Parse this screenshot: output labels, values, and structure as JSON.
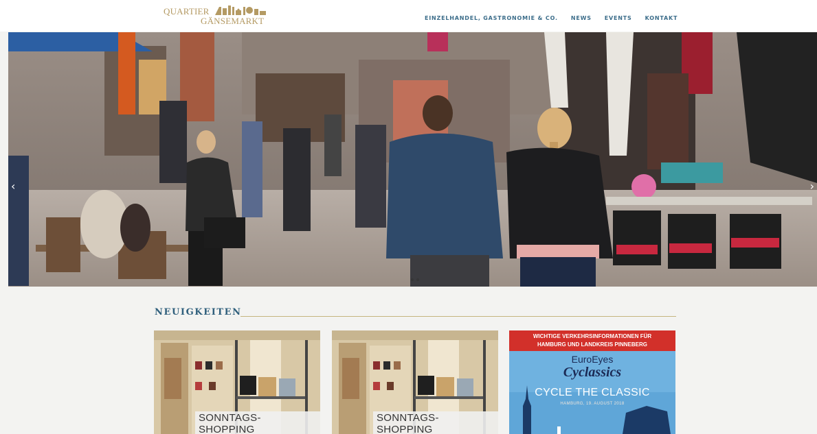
{
  "logo": {
    "line1": "QUARTIER",
    "line2": "GÄNSEMARKT"
  },
  "nav": {
    "items": [
      "EINZELHANDEL, GASTRONOMIE & CO.",
      "NEWS",
      "EVENTS",
      "KONTAKT"
    ]
  },
  "hero": {
    "prev_icon": "chevron-left-icon",
    "next_icon": "chevron-right-icon",
    "prev_glyph": "‹",
    "next_glyph": "›"
  },
  "news": {
    "title": "NEUIGKEITEN",
    "cards": [
      {
        "caption": "SONNTAGS-SHOPPING"
      },
      {
        "caption": "SONNTAGS-SHOPPING"
      },
      {
        "banner_line1": "WICHTIGE VERKEHRSINFORMATIONEN FÜR",
        "banner_line2": "HAMBURG UND LANDKREIS PINNEBERG",
        "brand": "EuroEyes",
        "event": "Cyclassics",
        "tagline": "CYCLE THE CLASSIC",
        "date": "HAMBURG, 19. AUGUST 2018"
      }
    ]
  },
  "colors": {
    "nav": "#3c6d8a",
    "gold": "#b49a63",
    "red_band": "#d2302a",
    "sky": "#5fa6d8"
  }
}
